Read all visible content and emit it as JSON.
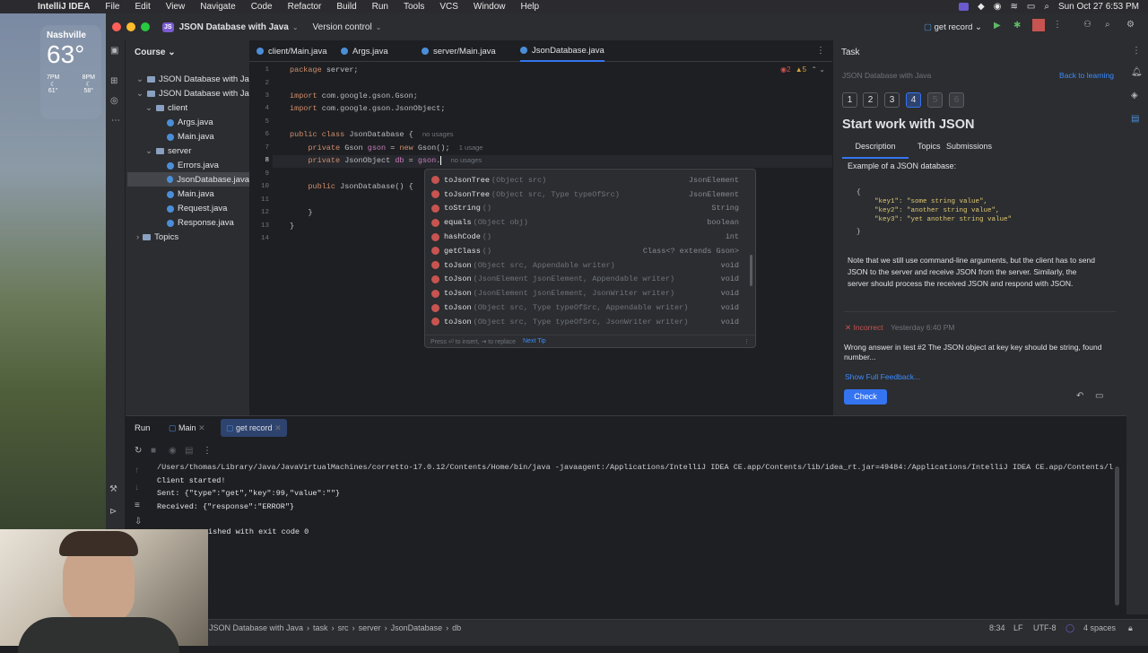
{
  "menubar": {
    "app": "IntelliJ IDEA",
    "items": [
      "File",
      "Edit",
      "View",
      "Navigate",
      "Code",
      "Refactor",
      "Build",
      "Run",
      "Tools",
      "VCS",
      "Window",
      "Help"
    ],
    "datetime": "Sun Oct 27  6:53 PM"
  },
  "weather": {
    "city": "Nashville",
    "temp": "63°",
    "hours": [
      {
        "t": "7PM",
        "v": "61°"
      },
      {
        "t": "8PM",
        "v": "58°"
      }
    ]
  },
  "titlebar": {
    "project_badge": "JS",
    "project": "JSON Database with Java",
    "vcs": "Version control",
    "run_config": "get record"
  },
  "project": {
    "header": "Course",
    "tree": [
      {
        "label": "JSON Database with Java",
        "depth": 0,
        "kind": "course"
      },
      {
        "label": "JSON Database with Java",
        "depth": 1,
        "kind": "dir"
      },
      {
        "label": "client",
        "depth": 2,
        "kind": "dir"
      },
      {
        "label": "Args.java",
        "depth": 3,
        "kind": "file"
      },
      {
        "label": "Main.java",
        "depth": 3,
        "kind": "file"
      },
      {
        "label": "server",
        "depth": 2,
        "kind": "dir"
      },
      {
        "label": "Errors.java",
        "depth": 3,
        "kind": "file"
      },
      {
        "label": "JsonDatabase.java",
        "depth": 3,
        "kind": "file"
      },
      {
        "label": "Main.java",
        "depth": 3,
        "kind": "file"
      },
      {
        "label": "Request.java",
        "depth": 3,
        "kind": "file"
      },
      {
        "label": "Response.java",
        "depth": 3,
        "kind": "file"
      },
      {
        "label": "Topics",
        "depth": 1,
        "kind": "dir"
      }
    ]
  },
  "tabs": [
    "client/Main.java",
    "Args.java",
    "server/Main.java",
    "JsonDatabase.java"
  ],
  "editor": {
    "errors": "2",
    "warnings": "5",
    "lines": [
      "1",
      "2",
      "3",
      "4",
      "5",
      "6",
      "7",
      "8",
      "9",
      "10",
      "11",
      "12",
      "13",
      "14"
    ],
    "code": {
      "l1": "package server;",
      "l3": "import com.google.gson.Gson;",
      "l4": "import com.google.gson.JsonObject;",
      "l6a": "public class ",
      "l6b": "JsonDatabase",
      " l6c": " {",
      "l6hint": "no usages",
      "l7a": "    private Gson ",
      "l7b": "gson",
      " l7c": " = new Gson();",
      "l7hint": "1 usage",
      "l8a": "    private JsonObject ",
      "l8b": "db",
      " l8c": " = gson.",
      "l8hint": "no usages",
      "l10a": "    public ",
      "l10b": "JsonDatabase",
      " l10c": "() {",
      "l12": "    }",
      "l13": "}"
    }
  },
  "popup": {
    "items": [
      {
        "name": "toJsonTree",
        "params": "(Object src)",
        "ret": "JsonElement"
      },
      {
        "name": "toJsonTree",
        "params": "(Object src, Type typeOfSrc)",
        "ret": "JsonElement"
      },
      {
        "name": "toString",
        "params": "()",
        "ret": "String"
      },
      {
        "name": "equals",
        "params": "(Object obj)",
        "ret": "boolean"
      },
      {
        "name": "hashCode",
        "params": "()",
        "ret": "int"
      },
      {
        "name": "getClass",
        "params": "()",
        "ret": "Class<? extends Gson>"
      },
      {
        "name": "toJson",
        "params": "(Object src, Appendable writer)",
        "ret": "void"
      },
      {
        "name": "toJson",
        "params": "(JsonElement jsonElement, Appendable writer)",
        "ret": "void"
      },
      {
        "name": "toJson",
        "params": "(JsonElement jsonElement, JsonWriter writer)",
        "ret": "void"
      },
      {
        "name": "toJson",
        "params": "(Object src, Type typeOfSrc, Appendable writer)",
        "ret": "void"
      },
      {
        "name": "toJson",
        "params": "(Object src, Type typeOfSrc, JsonWriter writer)",
        "ret": "void"
      }
    ],
    "footer": "Press ⏎ to insert, ⇥ to replace",
    "next_tip": "Next Tip"
  },
  "task": {
    "header": "Task",
    "course": "JSON Database with Java",
    "back": "Back to learning",
    "steps": [
      "1",
      "2",
      "3",
      "4",
      "5",
      "6"
    ],
    "current_step": 4,
    "title": "Start work with JSON",
    "tabs": [
      "Description",
      "Topics",
      "Submissions"
    ],
    "example_label": "Example of a JSON database:",
    "json_lines": [
      "{",
      "\"key1\": \"some string value\",",
      "\"key2\": \"another string value\",",
      "\"key3\": \"yet another string value\"",
      "}"
    ],
    "paragraph": "Note that we still use command-line arguments, but the client has to send JSON to the server and receive JSON from the server. Similarly, the server should process the received JSON and respond with JSON.",
    "status": "Incorrect",
    "status_time": "Yesterday 6:40 PM",
    "feedback": "Wrong answer in test #2 The JSON object at key key should be string, found number...",
    "show_feedback": "Show Full Feedback...",
    "check": "Check"
  },
  "bottom": {
    "run_label": "Run",
    "tabs": [
      "Main",
      "get record"
    ],
    "console": [
      "/Users/thomas/Library/Java/JavaVirtualMachines/corretto-17.0.12/Contents/Home/bin/java -javaagent:/Applications/IntelliJ IDEA CE.app/Contents/lib/idea_rt.jar=49484:/Applications/IntelliJ IDEA CE.app/Contents/l",
      "Client started!",
      "Sent: {\"type\":\"get\",\"key\":99,\"value\":\"\"}",
      "Received: {\"response\":\"ERROR\"}",
      "",
      "ished with exit code 0"
    ]
  },
  "status": {
    "breadcrumb": [
      "JSON Database with Java",
      "task",
      "src",
      "server",
      "JsonDatabase",
      "db"
    ],
    "pos": "8:34",
    "le": "LF",
    "enc": "UTF-8",
    "indent": "4 spaces"
  }
}
